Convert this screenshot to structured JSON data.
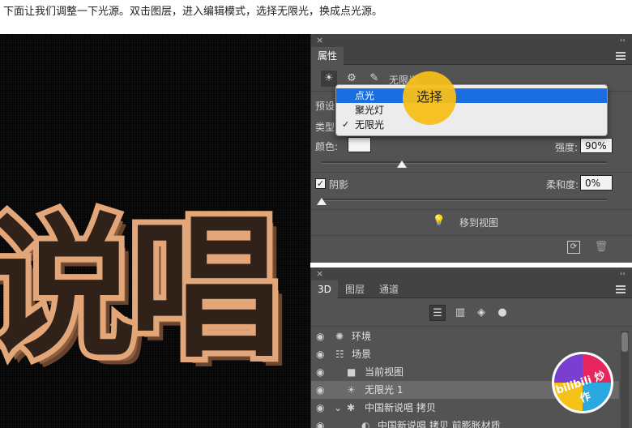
{
  "caption": "下面让我们调整一下光源。双击图层，进入编辑模式，选择无限光，换成点光源。",
  "canvas": {
    "art_text": "说唱"
  },
  "properties": {
    "close": "×",
    "collapse": "‹‹",
    "tab": "属性",
    "light_name": "无限光",
    "preset_label": "预设",
    "type_label": "类型",
    "color_label": "颜色:",
    "intensity_label": "强度:",
    "intensity_value": "90%",
    "shadow_label": "阴影",
    "softness_label": "柔和度:",
    "softness_value": "0%",
    "move_to_view": "移到视图",
    "intensity_level": 0.9,
    "softness_level": 0.0
  },
  "dropdown": {
    "items": [
      {
        "label": "点光",
        "selected": true,
        "checked": false
      },
      {
        "label": "聚光灯",
        "selected": false,
        "checked": false
      },
      {
        "label": "无限光",
        "selected": false,
        "checked": true
      }
    ],
    "check_mark": "✓"
  },
  "annotation": {
    "text": "选择"
  },
  "panel3d": {
    "close": "×",
    "collapse": "‹‹",
    "tabs": [
      {
        "label": "3D"
      },
      {
        "label": "图层"
      },
      {
        "label": "通道"
      }
    ],
    "layers": [
      {
        "name": "环境",
        "icon": "environment-icon"
      },
      {
        "name": "场景",
        "icon": "scene-icon"
      },
      {
        "name": "当前视图",
        "icon": "camera-icon"
      },
      {
        "name": "无限光 1",
        "icon": "sun-icon"
      },
      {
        "name": "中国新说唱 拷贝",
        "icon": "mesh-icon"
      },
      {
        "name": "中国新说唱 拷贝 前膨胀材质",
        "icon": "material-icon"
      }
    ]
  },
  "badge": {
    "text": "bilibili 炒作"
  },
  "colors": {
    "panel": "#535353",
    "selection": "#1a6ee0",
    "highlight": "#f5bf1a",
    "art": "#e2a679"
  }
}
